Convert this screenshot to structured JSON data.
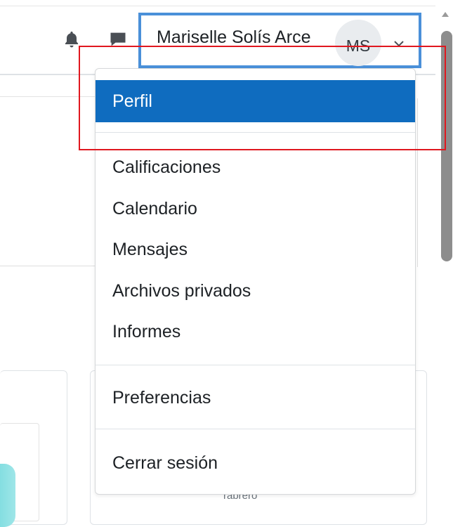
{
  "user_menu": {
    "user_name": "Mariselle Solís Arce",
    "avatar_initials": "MS"
  },
  "navbar": {
    "notifications_icon": "bell-icon",
    "messages_icon": "chat-bubble-icon",
    "menu_icon": "chevron-down-icon"
  },
  "dropdown": {
    "items": [
      {
        "label": "Perfil",
        "active": true
      },
      {
        "label": "Calificaciones"
      },
      {
        "label": "Calendario"
      },
      {
        "label": "Mensajes"
      },
      {
        "label": "Archivos privados"
      },
      {
        "label": "Informes"
      },
      {
        "label": "Preferencias"
      },
      {
        "label": "Cerrar sesión"
      }
    ]
  },
  "background": {
    "cut_text": "rabrero"
  },
  "colors": {
    "active_item": "#0f6cbf",
    "focus_ring": "#4a90d9",
    "highlight": "#e0171f"
  }
}
